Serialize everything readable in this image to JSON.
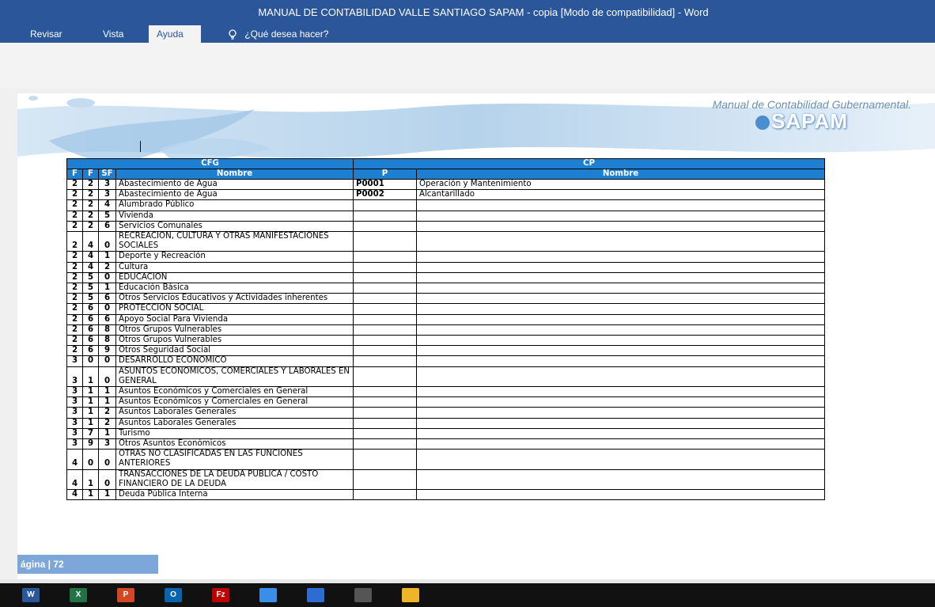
{
  "window": {
    "title": "MANUAL DE CONTABILIDAD VALLE SANTIAGO SAPAM - copia [Modo de compatibilidad]  -  Word"
  },
  "ribbon": {
    "tabs": [
      {
        "label": "Revisar"
      },
      {
        "label": "Vista"
      },
      {
        "label": "Ayuda"
      }
    ],
    "active_tab": "Ayuda",
    "tell_me": "¿Qué desea hacer?"
  },
  "document": {
    "header_title": "Manual de Contabilidad Gubernamental.",
    "logo_text": "SAPAM",
    "table": {
      "group_headers": [
        "CFG",
        "CP"
      ],
      "col_headers": [
        "F",
        "F",
        "SF",
        "Nombre",
        "P",
        "Nombre"
      ],
      "rows": [
        [
          "2",
          "2",
          "3",
          "Abastecimiento de Agua",
          "P0001",
          "Operación y Mantenimiento"
        ],
        [
          "2",
          "2",
          "3",
          "Abastecimiento de Agua",
          "P0002",
          "Alcantarillado"
        ],
        [
          "2",
          "2",
          "4",
          "Alumbrado Público",
          "",
          ""
        ],
        [
          "2",
          "2",
          "5",
          "Vivienda",
          "",
          ""
        ],
        [
          "2",
          "2",
          "6",
          "Servicios Comunales",
          "",
          ""
        ],
        [
          "2",
          "4",
          "0",
          "RECREACION, CULTURA Y OTRAS MANIFESTACIONES SOCIALES",
          "",
          ""
        ],
        [
          "2",
          "4",
          "1",
          "Deporte y Recreación",
          "",
          ""
        ],
        [
          "2",
          "4",
          "2",
          "Cultura",
          "",
          ""
        ],
        [
          "2",
          "5",
          "0",
          "EDUCACION",
          "",
          ""
        ],
        [
          "2",
          "5",
          "1",
          "Educación Básica",
          "",
          ""
        ],
        [
          "2",
          "5",
          "6",
          "Otros Servicios Educativos y Actividades inherentes",
          "",
          ""
        ],
        [
          "2",
          "6",
          "0",
          " PROTECCION SOCIAL",
          "",
          ""
        ],
        [
          "2",
          "6",
          "6",
          "Apoyo Social Para Vivienda",
          "",
          ""
        ],
        [
          "2",
          "6",
          "8",
          "Otros Grupos Vulnerables",
          "",
          ""
        ],
        [
          "2",
          "6",
          "8",
          "Otros Grupos Vulnerables",
          "",
          ""
        ],
        [
          "2",
          "6",
          "9",
          "Otros Seguridad Social",
          "",
          ""
        ],
        [
          "3",
          "0",
          "0",
          "DESARROLLO ECONOMICO",
          "",
          ""
        ],
        [
          "3",
          "1",
          "0",
          "ASUNTOS ECONOMICOS, COMERCIALES Y LABORALES EN GENERAL",
          "",
          ""
        ],
        [
          "3",
          "1",
          "1",
          "Asuntos Económicos y Comerciales en General",
          "",
          ""
        ],
        [
          "3",
          "1",
          "1",
          "Asuntos Económicos y Comerciales en General",
          "",
          ""
        ],
        [
          "3",
          "1",
          "2",
          "Asuntos Laborales Generales",
          "",
          ""
        ],
        [
          "3",
          "1",
          "2",
          "Asuntos Laborales Generales",
          "",
          ""
        ],
        [
          "3",
          "7",
          "1",
          "Turismo",
          "",
          ""
        ],
        [
          "3",
          "9",
          "3",
          "Otros Asuntos Económicos",
          "",
          ""
        ],
        [
          "4",
          "0",
          "0",
          "OTRAS NO CLASIFICADAS EN LAS FUNCIONES ANTERIORES",
          "",
          ""
        ],
        [
          "4",
          "1",
          "0",
          "TRANSACCIONES DE LA DEUDA PUBLICA / COSTO FINANCIERO DE LA DEUDA",
          "",
          ""
        ],
        [
          "4",
          "1",
          "1",
          "Deuda Pública Interna",
          "",
          ""
        ]
      ]
    },
    "footer": "ágina | 72"
  },
  "taskbar": {
    "apps": [
      {
        "icon": "word-icon",
        "label": "W",
        "color": "#2b579a"
      },
      {
        "icon": "excel-icon",
        "label": "X",
        "color": "#217346"
      },
      {
        "icon": "powerpoint-icon",
        "label": "P",
        "color": "#d24726"
      },
      {
        "icon": "outlook-icon",
        "label": "O",
        "color": "#0a64ad"
      },
      {
        "icon": "filezilla-icon",
        "label": "Fz",
        "color": "#bf0000"
      },
      {
        "icon": "chrome-icon",
        "label": "",
        "color": "#3b8ee8"
      },
      {
        "icon": "pen-icon",
        "label": "",
        "color": "#2e6cd1"
      },
      {
        "icon": "calculator-icon",
        "label": "",
        "color": "#555555"
      },
      {
        "icon": "folder-icon",
        "label": "",
        "color": "#f0b429"
      }
    ]
  }
}
